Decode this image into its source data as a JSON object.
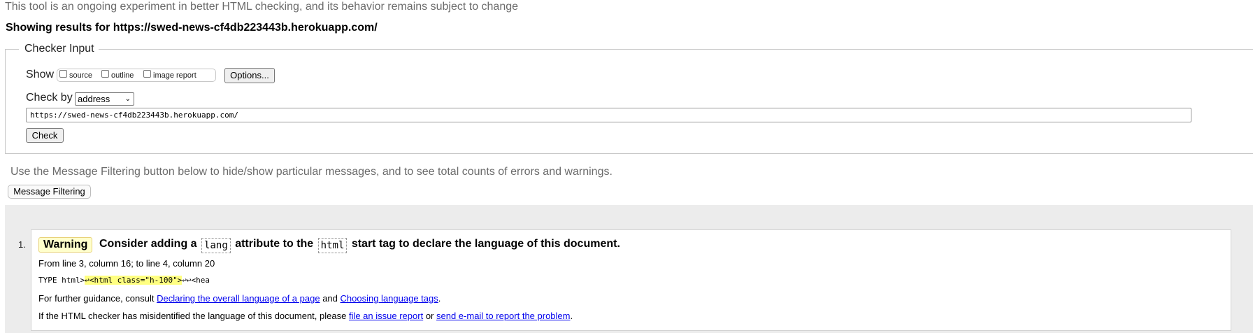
{
  "banner": "This tool is an ongoing experiment in better HTML checking, and its behavior remains subject to change",
  "results_heading": "Showing results for https://swed-news-cf4db223443b.herokuapp.com/",
  "checker_input": {
    "legend": "Checker Input",
    "show_label": "Show",
    "checkboxes": [
      {
        "label": "source",
        "checked": false
      },
      {
        "label": "outline",
        "checked": false
      },
      {
        "label": "image report",
        "checked": false
      }
    ],
    "options_button": "Options...",
    "check_by_label": "Check by",
    "check_by_selected": "address",
    "url_value": "https://swed-news-cf4db223443b.herokuapp.com/",
    "check_button": "Check"
  },
  "filter_note": "Use the Message Filtering button below to hide/show particular messages, and to see total counts of errors and warnings.",
  "filter_button": "Message Filtering",
  "colors": {
    "warning_badge_bg": "#ffffcc",
    "highlight": "#ffff80",
    "link": "#0000ee",
    "results_bg": "#ececec"
  },
  "messages": [
    {
      "number": "1.",
      "type": "Warning",
      "text_parts": [
        "Consider adding a",
        "lang",
        "attribute to the",
        "html",
        "start tag to declare the language of this document."
      ],
      "location": "From line 3, column 16; to line 4, column 20",
      "extract_before": "TYPE html>",
      "extract_highlight": "↩<html class=\"h-100\">",
      "extract_after": "↩↩<hea",
      "guidance_prefix": "For further guidance, consult",
      "guidance_link1": "Declaring the overall language of a page",
      "guidance_and": "and",
      "guidance_link2": "Choosing language tags",
      "guidance_end": ".",
      "misid_prefix": "If the HTML checker has misidentified the language of this document, please",
      "misid_link1": "file an issue report",
      "misid_or": "or",
      "misid_link2": "send e-mail to report the problem",
      "misid_end": "."
    }
  ]
}
